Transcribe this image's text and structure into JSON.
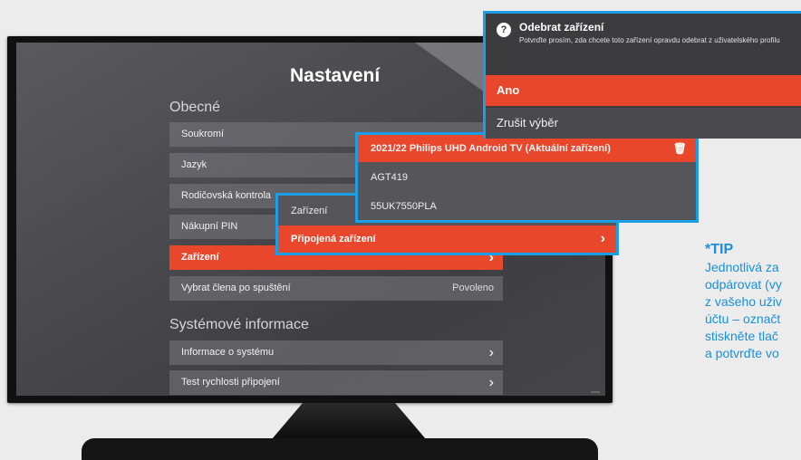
{
  "screen": {
    "title": "Nastavení",
    "section_general": "Obecné",
    "general_items": [
      {
        "label": "Soukromí"
      },
      {
        "label": "Jazyk"
      },
      {
        "label": "Rodičovská kontrola"
      },
      {
        "label": "Nákupní PIN"
      },
      {
        "label": "Zařízení"
      },
      {
        "label": "Vybrat člena po spuštění",
        "value": "Povoleno"
      }
    ],
    "section_system": "Systémové informace",
    "system_items": [
      {
        "label": "Informace o systému"
      },
      {
        "label": "Test rychlosti připojení"
      }
    ]
  },
  "submenu": {
    "header": "Zařízení",
    "item": "Připojená zařízení"
  },
  "devices": [
    {
      "label": "2021/22 Philips UHD Android TV (Aktuální zařízení)"
    },
    {
      "label": "AGT419"
    },
    {
      "label": "55UK7550PLA"
    }
  ],
  "dialog": {
    "title": "Odebrat zařízení",
    "message": "Potvrďte prosím, zda chcete toto zařízení opravdu odebrat z uživatelského profilu",
    "confirm": "Ano",
    "cancel": "Zrušit výběr"
  },
  "tip": {
    "title": "*TIP",
    "lines": [
      "Jednotlivá za",
      "odpárovat (vy",
      "z vašeho uživ",
      "účtu – označt",
      "stiskněte tlač",
      "a potvrďte vo"
    ]
  },
  "colors": {
    "accent": "#e8472b",
    "highlight_border": "#1a9ee5",
    "tip": "#1a8fd8"
  }
}
